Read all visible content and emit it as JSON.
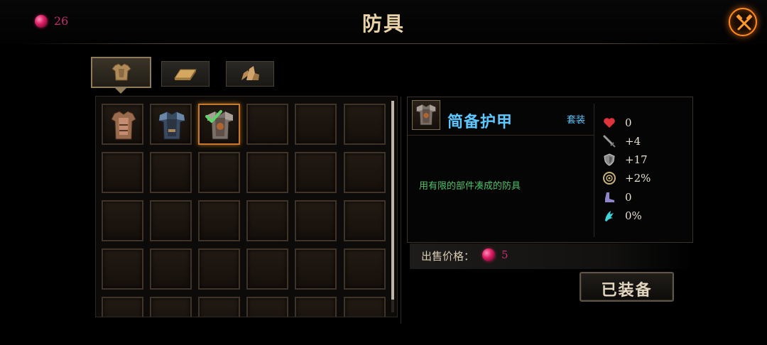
{
  "header": {
    "currency_icon": "pink-gem-icon",
    "currency_count": "26",
    "title": "防具",
    "close_icon": "crossed-hammers-icon"
  },
  "tabs": [
    {
      "name": "armor",
      "icon": "armor-icon",
      "active": true
    },
    {
      "name": "material-bar",
      "icon": "ingot-icon",
      "active": false
    },
    {
      "name": "ore",
      "icon": "ore-icon",
      "active": false
    }
  ],
  "inventory": {
    "columns": 6,
    "visible_rows": 5,
    "items": [
      {
        "slot": 0,
        "icon": "leather-armor-icon"
      },
      {
        "slot": 1,
        "icon": "blue-plate-armor-icon"
      },
      {
        "slot": 2,
        "icon": "steel-armor-icon",
        "selected": true,
        "equipped": true
      }
    ]
  },
  "detail": {
    "icon": "steel-armor-icon",
    "name": "简备护甲",
    "set_label": "套装",
    "description": "用有限的部件凑成的防具",
    "stats": [
      {
        "icon": "heart-icon",
        "value": "0",
        "color": "#e0343a"
      },
      {
        "icon": "sword-icon",
        "value": "+4",
        "color": "#9a9a9a"
      },
      {
        "icon": "shield-icon",
        "value": "+17",
        "color": "#9a9a9a"
      },
      {
        "icon": "crit-icon",
        "value": "+2%",
        "color": "#c9b27a"
      },
      {
        "icon": "boot-icon",
        "value": "0",
        "color": "#8e86c8"
      },
      {
        "icon": "evasion-icon",
        "value": "0%",
        "color": "#3fd4d8"
      }
    ]
  },
  "sell": {
    "label": "出售价格：",
    "icon": "pink-gem-icon",
    "value": "5"
  },
  "equip_button": {
    "label": "已装备"
  },
  "colors": {
    "accent_orange": "#ff8a1e",
    "gem_pink": "#c42e6e",
    "item_name_blue": "#5fc7ff",
    "desc_green": "#4fc36a"
  }
}
